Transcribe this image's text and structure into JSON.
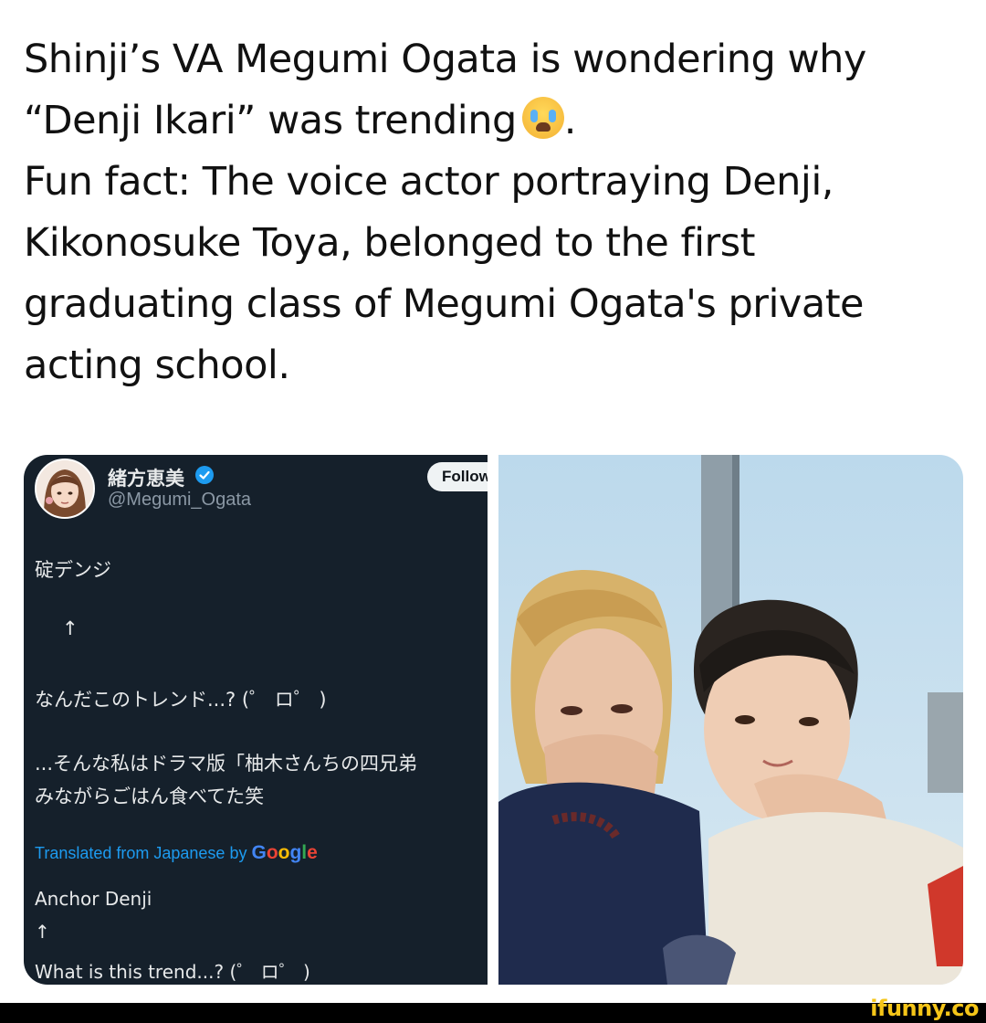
{
  "caption": {
    "line1": "Shinji’s VA Megumi Ogata is wondering why",
    "line2": "“Denji Ikari” was trending",
    "line2_end": ".",
    "line3": "Fun fact: The voice actor portraying Denji,",
    "line4": "Kikonosuke Toya, belonged to the first",
    "line5": "graduating class of Megumi Ogata's private",
    "line6": "acting school.",
    "emoji": "loudly-crying-face-emoji"
  },
  "tweet": {
    "display_name": "緒方恵美",
    "handle": "@Megumi_Ogata",
    "follow_label": "Follow",
    "ja_line1": "碇デンジ",
    "ja_arrow": "↑",
    "ja_line2": "なんだこのトレンド...? (゜ ロ゜ )",
    "ja_line3": "...そんな私はドラマ版「柚木さんちの四兄弟",
    "ja_line4": "みながらごはん食べてた笑",
    "translated_prefix": "Translated from Japanese by",
    "translated_brand": "Google",
    "en_line1": "Anchor Denji",
    "en_arrow": "↑",
    "en_line2": "What is this trend...? (゜ ロ゜ )"
  },
  "footer": {
    "watermark": "ifunny.co"
  },
  "colors": {
    "tweet_bg": "#15202b",
    "link_blue": "#1d9bf0",
    "verified_blue": "#1d9bf0",
    "watermark_yellow": "#f5c518"
  }
}
